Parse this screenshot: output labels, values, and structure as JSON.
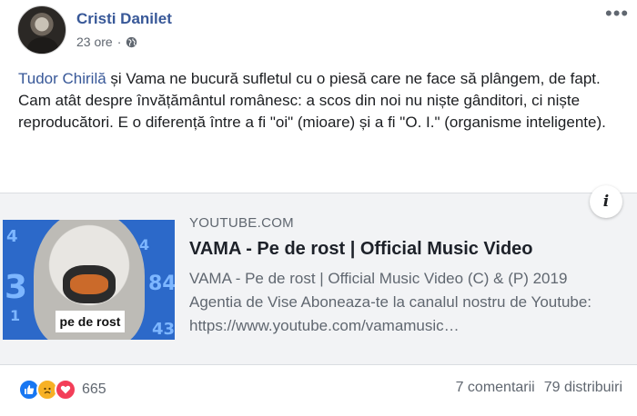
{
  "post": {
    "author": "Cristi Danilet",
    "time": "23 ore",
    "separator": "·",
    "privacy_icon": "globe-icon",
    "more_icon": "more-options-icon",
    "more_glyph": "•••",
    "text": {
      "mention": "Tudor Chirilă",
      "line1_rest": " și Vama ne bucură sufletul cu o piesă care ne face să plângem, de fapt.",
      "line2": "Cam atât despre învățământul românesc: a scos din noi nu niște gânditori, ci niște reproducători. E o diferență între a fi \"oi\" (mioare) și a fi \"O. I.\" (organisme inteligente)."
    }
  },
  "link_card": {
    "domain": "YOUTUBE.COM",
    "title": "VAMA - Pe de rost | Official Music Video",
    "description": "VAMA - Pe de rost | Official Music Video (C) & (P) 2019 Agentia de Vise Aboneaza-te la canalul nostru de Youtube: https://www.youtube.com/vamamusic…",
    "thumbnail_caption": "pe de rost",
    "info_glyph": "i",
    "colors": {
      "thumb_bg": "#2c69c9",
      "mask": "#e8752a"
    }
  },
  "footer": {
    "reaction_icons": [
      "like-icon",
      "sad-icon",
      "love-icon"
    ],
    "reaction_count": "665",
    "comments": "7 comentarii",
    "shares": "79 distribuiri"
  }
}
